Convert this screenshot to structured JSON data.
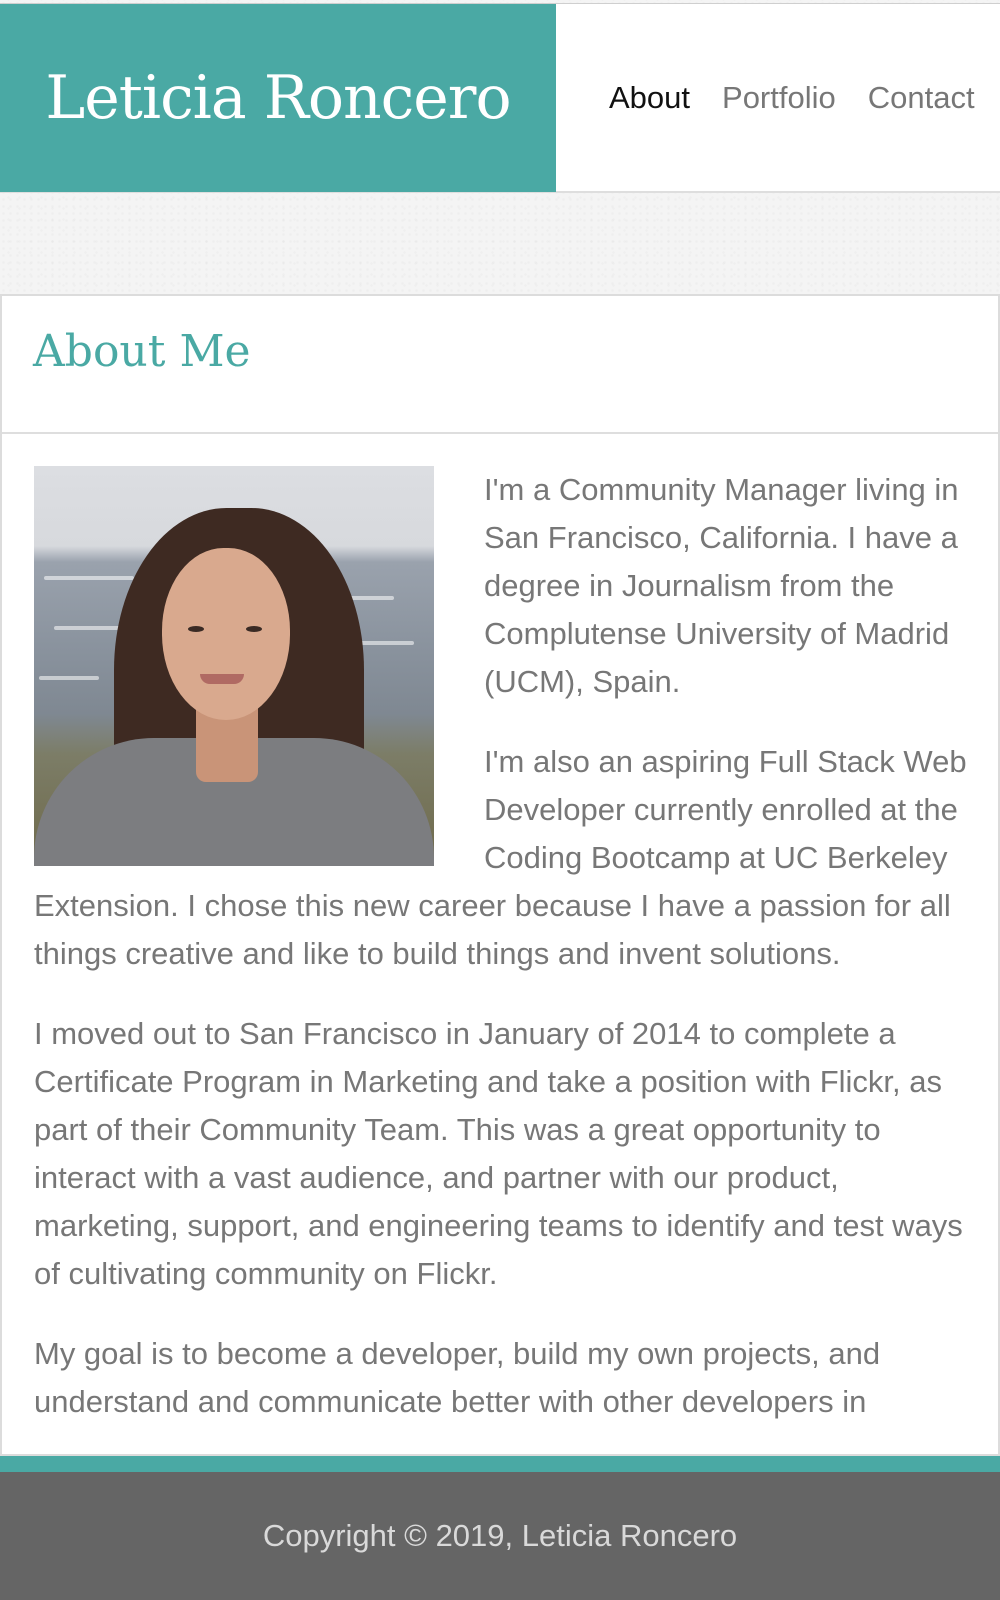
{
  "header": {
    "brand": "Leticia Roncero",
    "nav": [
      {
        "label": "About",
        "active": true
      },
      {
        "label": "Portfolio",
        "active": false
      },
      {
        "label": "Contact",
        "active": false
      }
    ]
  },
  "colors": {
    "accent": "#4aa9a4",
    "footer_bg": "#656565",
    "body_text": "#777777"
  },
  "about": {
    "title": "About Me",
    "paragraphs": [
      "I'm a Community Manager living in San Francisco, California. I have a degree in Journalism from the Complutense University of Madrid (UCM), Spain.",
      "I'm also an aspiring Full Stack Web Developer currently enrolled at the Coding Bootcamp at UC Berkeley Extension. I chose this new career because I have a passion for all things creative and like to build things and invent solutions.",
      "I moved out to San Francisco in January of 2014 to complete a Certificate Program in Marketing and take a position with Flickr, as part of their Community Team. This was a great opportunity to interact with a vast audience, and partner with our product, marketing, support, and engineering teams to identify and test ways of cultivating community on Flickr.",
      "My goal is to become a developer, build my own projects, and understand and communicate better with other developers in"
    ]
  },
  "footer": {
    "copyright": "Copyright © 2019, Leticia Roncero"
  }
}
